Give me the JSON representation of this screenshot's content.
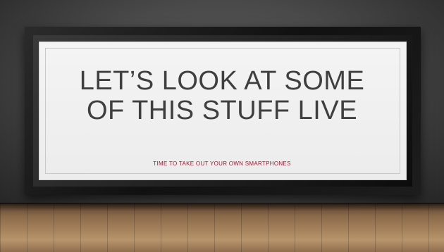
{
  "slide": {
    "title_line1": "LET’S LOOK AT SOME",
    "title_line2": "OF THIS STUFF LIVE",
    "subtitle": "TIME TO TAKE OUT YOUR OWN SMARTPHONES"
  },
  "colors": {
    "title": "#3f3f3f",
    "subtitle": "#a3172f",
    "mat": "#f0f0f0",
    "frame": "#1a1a1a",
    "wall": "#4a4a4a",
    "floor": "#a7835d"
  }
}
